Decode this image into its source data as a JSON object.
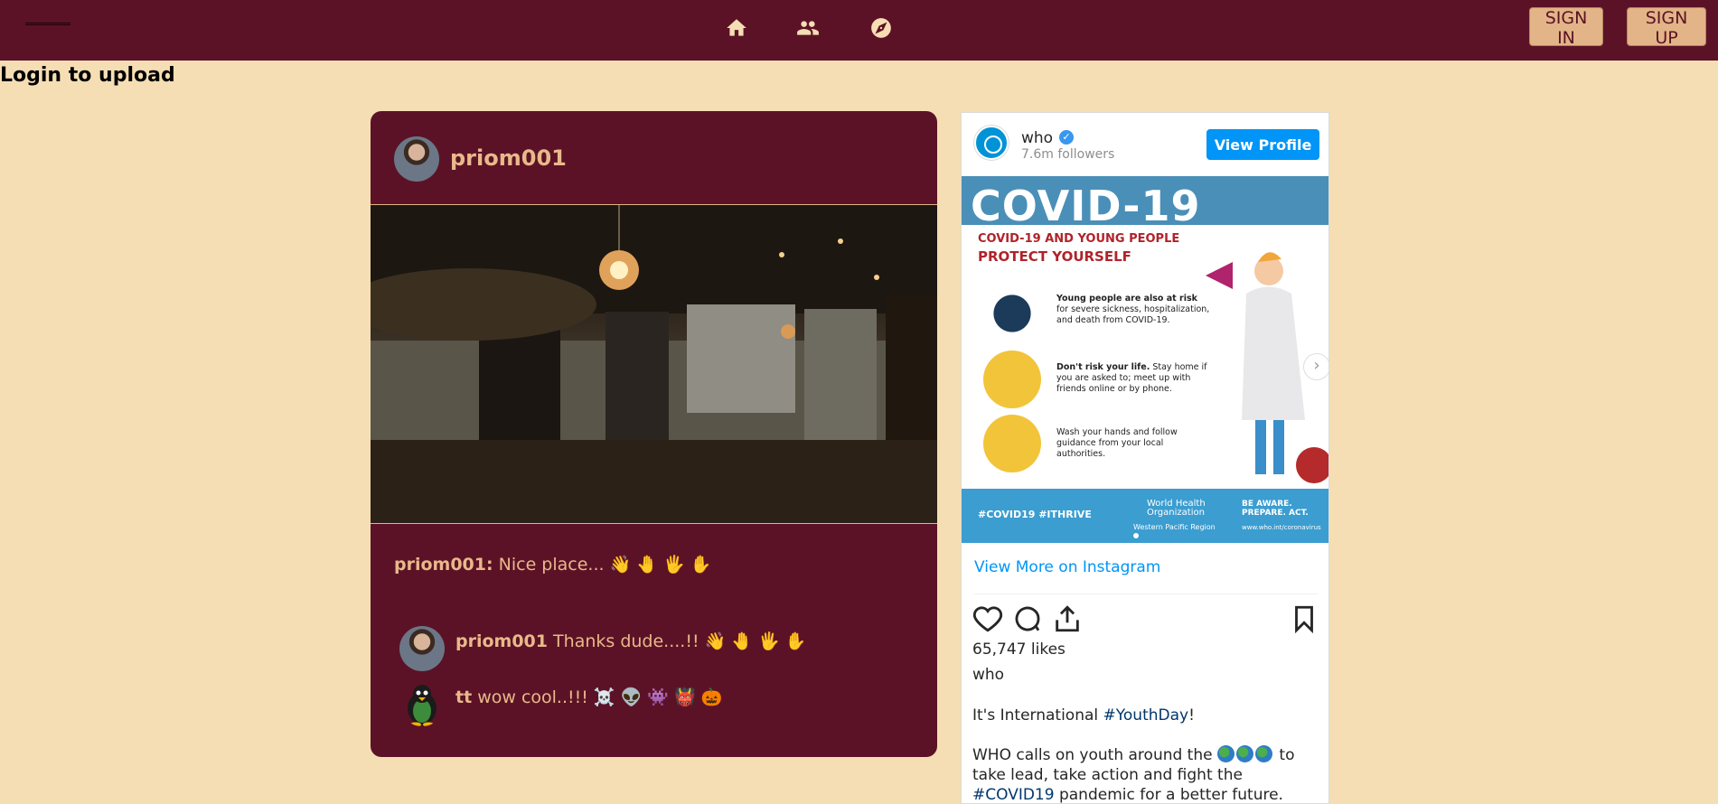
{
  "navbar": {
    "sign_in_label": "SIGN IN",
    "sign_up_label": "SIGN UP",
    "icons": [
      "home-icon",
      "people-icon",
      "compass-icon"
    ],
    "background_color": "#5c1226",
    "accent_color": "#f5deb3"
  },
  "page": {
    "login_prompt": "Login to upload",
    "background_color": "#f5deb3"
  },
  "post": {
    "username": "priom001",
    "caption_user": "priom001:",
    "caption_text": "Nice place... 👋 🤚 🖐 ✋",
    "comments": [
      {
        "user": "priom001",
        "text": "Thanks dude....!! 👋 🤚 🖐 ✋"
      },
      {
        "user": "tt",
        "text": "wow cool..!!! ☠️ 👽 👾 👹 🎃"
      }
    ]
  },
  "instagram": {
    "account": "who",
    "followers": "7.6m followers",
    "view_profile_label": "View Profile",
    "image": {
      "title": "COVID-19",
      "subtitle_1a": "COVID-19",
      "subtitle_1b": "AND YOUNG PEOPLE",
      "subtitle_2": "PROTECT YOURSELF",
      "points": [
        {
          "bold": "Young people are also at risk",
          "text": "for severe sickness, hospitalization, and death from COVID-19."
        },
        {
          "bold": "Don't risk your life.",
          "text": "Stay home if you are asked to; meet up with friends online or by phone."
        },
        {
          "bold": "",
          "text": "Wash your hands and follow guidance from your local authorities."
        }
      ],
      "tags": "#COVID19   #ITHRIVE",
      "org_line_1": "World Health",
      "org_line_2": "Organization",
      "aware_1": "BE AWARE.",
      "aware_2": "PREPARE. ACT.",
      "region": "Western Pacific Region",
      "url": "www.who.int/coronavirus"
    },
    "view_more_label": "View More on Instagram",
    "likes": "65,747 likes",
    "owner": "who",
    "caption_line_1_prefix": "It's International ",
    "caption_line_1_tag": "#YouthDay",
    "caption_line_1_suffix": "!",
    "caption_line_2_prefix": "WHO calls on youth around the",
    "caption_line_2_mid": "to take lead, take action and fight the ",
    "caption_line_2_tag": "#COVID19",
    "caption_line_2_suffix": "pandemic for a better future.",
    "action_icons": [
      "heart-icon",
      "comment-icon",
      "share-icon",
      "bookmark-icon"
    ],
    "link_color": "#00376b",
    "button_color": "#0095f6"
  }
}
